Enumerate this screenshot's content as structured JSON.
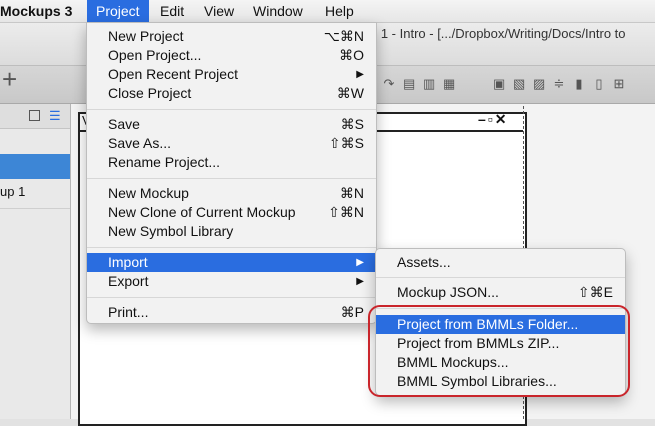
{
  "menubar": {
    "app_name": "Mockups 3",
    "items": [
      "Project",
      "Edit",
      "View",
      "Window",
      "Help"
    ]
  },
  "window": {
    "title_fragment": "p 1 - Intro - [.../Dropbox/Writing/Docs/Intro to"
  },
  "toolbar": {
    "add_label": "+"
  },
  "sidebar": {
    "item_label": "up 1"
  },
  "mockup": {
    "corner_letter": "V",
    "window_controls": "–▫✕"
  },
  "project_menu": {
    "items": [
      {
        "label": "New Project",
        "shortcut": "⌥⌘N"
      },
      {
        "label": "Open Project...",
        "shortcut": "⌘O"
      },
      {
        "label": "Open Recent Project",
        "shortcut": "▶"
      },
      {
        "label": "Close Project",
        "shortcut": "⌘W"
      },
      {
        "label": "Save",
        "shortcut": "⌘S"
      },
      {
        "label": "Save As...",
        "shortcut": "⇧⌘S"
      },
      {
        "label": "Rename Project...",
        "shortcut": ""
      },
      {
        "label": "New Mockup",
        "shortcut": "⌘N"
      },
      {
        "label": "New Clone of Current Mockup",
        "shortcut": "⇧⌘N"
      },
      {
        "label": "New Symbol Library",
        "shortcut": ""
      },
      {
        "label": "Import",
        "shortcut": "▶"
      },
      {
        "label": "Export",
        "shortcut": "▶"
      },
      {
        "label": "Print...",
        "shortcut": "⌘P"
      }
    ]
  },
  "import_menu": {
    "items": [
      {
        "label": "Assets...",
        "shortcut": ""
      },
      {
        "label": "Mockup JSON...",
        "shortcut": "⇧⌘E"
      },
      {
        "label": "Project from BMMLs Folder...",
        "shortcut": ""
      },
      {
        "label": "Project from BMMLs ZIP...",
        "shortcut": ""
      },
      {
        "label": "BMML Mockups...",
        "shortcut": ""
      },
      {
        "label": "BMML Symbol Libraries...",
        "shortcut": ""
      }
    ]
  },
  "colors": {
    "highlight": "#2a6de0",
    "annotation_ring": "#c9252b"
  }
}
